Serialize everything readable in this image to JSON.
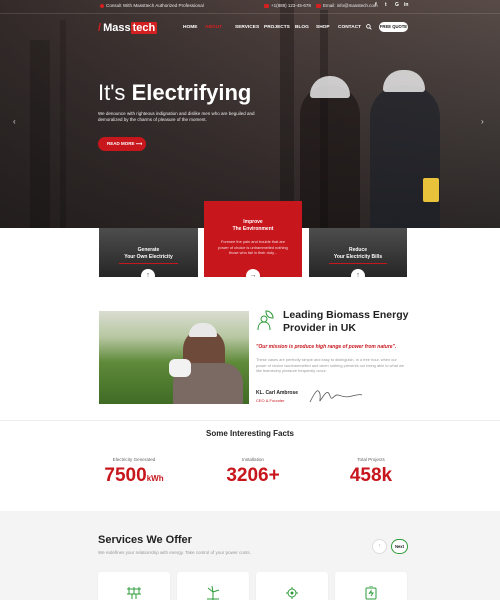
{
  "topbar": {
    "notice": "Consult With Massttech Authorized Professional",
    "phone": "+1(888) 123-45-678",
    "email": "Email: info@masstech.com",
    "social_icons": [
      "facebook-icon",
      "twitter-icon",
      "google-plus-icon",
      "linkedin-icon"
    ],
    "social_glyphs": [
      "f",
      "t",
      "G",
      "in"
    ]
  },
  "brand": {
    "part1": "Mass",
    "part2": "tech"
  },
  "nav": {
    "items": [
      "HOME",
      "ABOUT",
      "SERVICES",
      "PROJECTS",
      "BLOG",
      "SHOP",
      "CONTACT"
    ],
    "active_index": 1,
    "quote_button": "FREE QUOTE"
  },
  "hero": {
    "title_light": "It's",
    "title_bold": "Electrifying",
    "subtitle": "We denounce with righteous indignation and dislike men who are beguiled and demoralized by the charms of pleasure of the moment.",
    "read_more": "READ MORE"
  },
  "features": [
    {
      "title_line1": "Generate",
      "title_line2": "Your Own Electricity"
    },
    {
      "title_line1": "Improve",
      "title_line2": "The Environment",
      "description": "Foresee the pain and trouble that are power of choice is untrammelled nothing those who fail in their duty..."
    },
    {
      "title_line1": "Reduce",
      "title_line2": "Your Electricity Bills"
    }
  ],
  "about": {
    "title": "Leading Biomass Energy Provider in UK",
    "mission": "\"Our mission is produce high range of power from nature\".",
    "text": "These cases are perfectly simple and easy to distinguish. In a free hour, when our power of choice isuntrammelled and when nothing prevents our being able to what we like teamevery pleasure frequently occur.",
    "ceo_name": "KL. Carl Ambrose",
    "ceo_role": "CEO & Founder"
  },
  "facts": {
    "title": "Some Interesting Facts",
    "items": [
      {
        "label": "Electricity Generated",
        "value": "7500",
        "unit": "kWh"
      },
      {
        "label": "Installation",
        "value": "3206+",
        "unit": ""
      },
      {
        "label": "Total Projects",
        "value": "458k",
        "unit": ""
      }
    ]
  },
  "services": {
    "title": "Services We Offer",
    "subtitle": "We redefines your relationship with energy. Take control of your power costs.",
    "prev_glyph": "‹",
    "next_label": "Next",
    "card_icons": [
      "solar-panel-icon",
      "wind-turbine-icon",
      "gear-leaf-icon",
      "battery-icon"
    ]
  },
  "colors": {
    "accent": "#c8161d",
    "green": "#2e9b3a"
  }
}
